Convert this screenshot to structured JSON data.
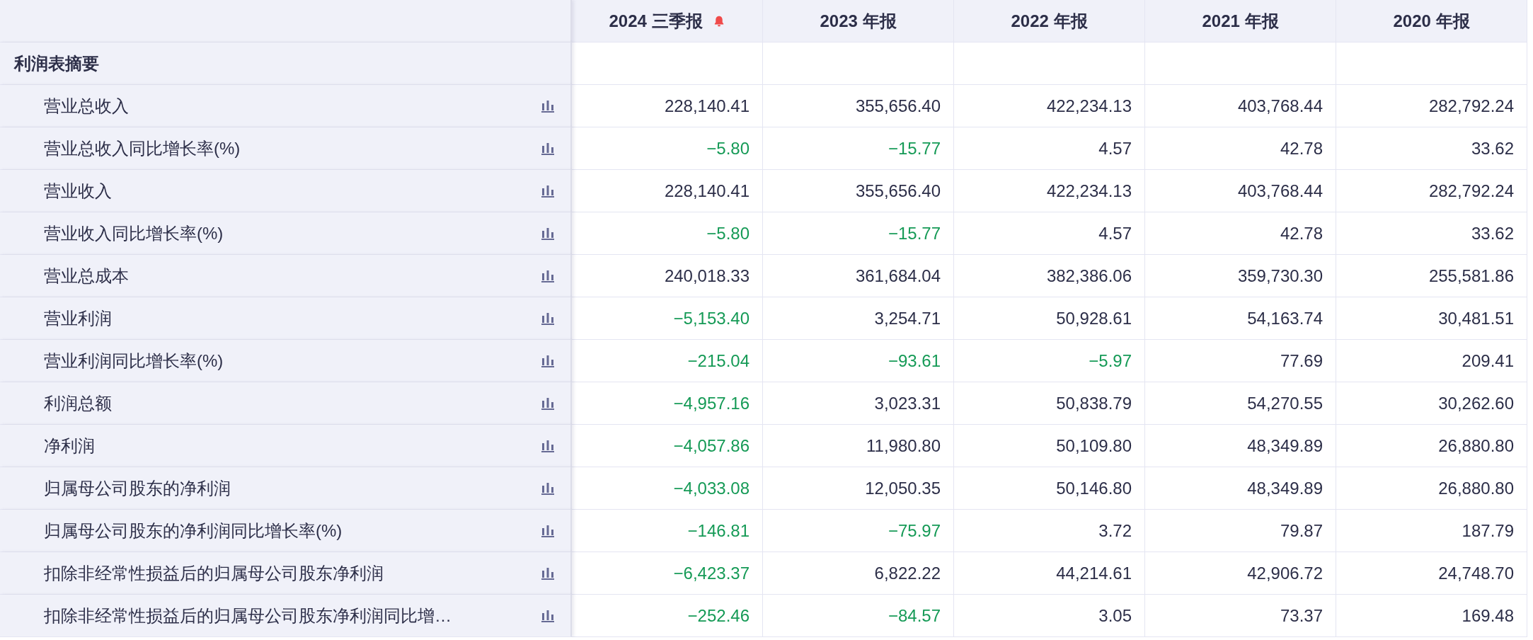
{
  "table": {
    "columns": [
      {
        "label": "2024 三季报",
        "alert": true
      },
      {
        "label": "2023 年报",
        "alert": false
      },
      {
        "label": "2022 年报",
        "alert": false
      },
      {
        "label": "2021 年报",
        "alert": false
      },
      {
        "label": "2020 年报",
        "alert": false
      }
    ],
    "section": "利润表摘要",
    "rows": [
      {
        "label": "营业总收入",
        "cells": [
          {
            "text": "228,140.41",
            "negative": false
          },
          {
            "text": "355,656.40",
            "negative": false
          },
          {
            "text": "422,234.13",
            "negative": false
          },
          {
            "text": "403,768.44",
            "negative": false
          },
          {
            "text": "282,792.24",
            "negative": false
          }
        ]
      },
      {
        "label": "营业总收入同比增长率(%)",
        "cells": [
          {
            "text": "−5.80",
            "negative": true
          },
          {
            "text": "−15.77",
            "negative": true
          },
          {
            "text": "4.57",
            "negative": false
          },
          {
            "text": "42.78",
            "negative": false
          },
          {
            "text": "33.62",
            "negative": false
          }
        ]
      },
      {
        "label": "营业收入",
        "cells": [
          {
            "text": "228,140.41",
            "negative": false
          },
          {
            "text": "355,656.40",
            "negative": false
          },
          {
            "text": "422,234.13",
            "negative": false
          },
          {
            "text": "403,768.44",
            "negative": false
          },
          {
            "text": "282,792.24",
            "negative": false
          }
        ]
      },
      {
        "label": "营业收入同比增长率(%)",
        "cells": [
          {
            "text": "−5.80",
            "negative": true
          },
          {
            "text": "−15.77",
            "negative": true
          },
          {
            "text": "4.57",
            "negative": false
          },
          {
            "text": "42.78",
            "negative": false
          },
          {
            "text": "33.62",
            "negative": false
          }
        ]
      },
      {
        "label": "营业总成本",
        "cells": [
          {
            "text": "240,018.33",
            "negative": false
          },
          {
            "text": "361,684.04",
            "negative": false
          },
          {
            "text": "382,386.06",
            "negative": false
          },
          {
            "text": "359,730.30",
            "negative": false
          },
          {
            "text": "255,581.86",
            "negative": false
          }
        ]
      },
      {
        "label": "营业利润",
        "cells": [
          {
            "text": "−5,153.40",
            "negative": true
          },
          {
            "text": "3,254.71",
            "negative": false
          },
          {
            "text": "50,928.61",
            "negative": false
          },
          {
            "text": "54,163.74",
            "negative": false
          },
          {
            "text": "30,481.51",
            "negative": false
          }
        ]
      },
      {
        "label": "营业利润同比增长率(%)",
        "cells": [
          {
            "text": "−215.04",
            "negative": true
          },
          {
            "text": "−93.61",
            "negative": true
          },
          {
            "text": "−5.97",
            "negative": true
          },
          {
            "text": "77.69",
            "negative": false
          },
          {
            "text": "209.41",
            "negative": false
          }
        ]
      },
      {
        "label": "利润总额",
        "cells": [
          {
            "text": "−4,957.16",
            "negative": true
          },
          {
            "text": "3,023.31",
            "negative": false
          },
          {
            "text": "50,838.79",
            "negative": false
          },
          {
            "text": "54,270.55",
            "negative": false
          },
          {
            "text": "30,262.60",
            "negative": false
          }
        ]
      },
      {
        "label": "净利润",
        "cells": [
          {
            "text": "−4,057.86",
            "negative": true
          },
          {
            "text": "11,980.80",
            "negative": false
          },
          {
            "text": "50,109.80",
            "negative": false
          },
          {
            "text": "48,349.89",
            "negative": false
          },
          {
            "text": "26,880.80",
            "negative": false
          }
        ]
      },
      {
        "label": "归属母公司股东的净利润",
        "cells": [
          {
            "text": "−4,033.08",
            "negative": true
          },
          {
            "text": "12,050.35",
            "negative": false
          },
          {
            "text": "50,146.80",
            "negative": false
          },
          {
            "text": "48,349.89",
            "negative": false
          },
          {
            "text": "26,880.80",
            "negative": false
          }
        ]
      },
      {
        "label": "归属母公司股东的净利润同比增长率(%)",
        "cells": [
          {
            "text": "−146.81",
            "negative": true
          },
          {
            "text": "−75.97",
            "negative": true
          },
          {
            "text": "3.72",
            "negative": false
          },
          {
            "text": "79.87",
            "negative": false
          },
          {
            "text": "187.79",
            "negative": false
          }
        ]
      },
      {
        "label": "扣除非经常性损益后的归属母公司股东净利润",
        "cells": [
          {
            "text": "−6,423.37",
            "negative": true
          },
          {
            "text": "6,822.22",
            "negative": false
          },
          {
            "text": "44,214.61",
            "negative": false
          },
          {
            "text": "42,906.72",
            "negative": false
          },
          {
            "text": "24,748.70",
            "negative": false
          }
        ]
      },
      {
        "label": "扣除非经常性损益后的归属母公司股东净利润同比增…",
        "cells": [
          {
            "text": "−252.46",
            "negative": true
          },
          {
            "text": "−84.57",
            "negative": true
          },
          {
            "text": "3.05",
            "negative": false
          },
          {
            "text": "73.37",
            "negative": false
          },
          {
            "text": "169.48",
            "negative": false
          }
        ]
      }
    ]
  }
}
